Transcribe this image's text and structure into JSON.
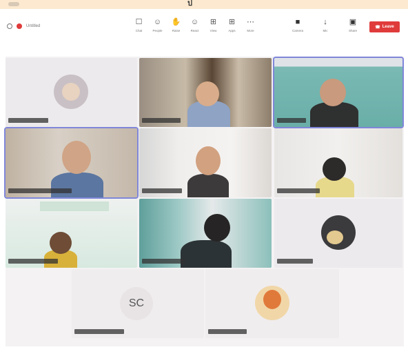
{
  "banner": {
    "text": "ป"
  },
  "toolbar": {
    "title": "Untitled",
    "items": [
      {
        "icon": "chat-icon",
        "glyph": "☐",
        "label": "Chat"
      },
      {
        "icon": "people-icon",
        "glyph": "☺",
        "label": "People"
      },
      {
        "icon": "raise-hand-icon",
        "glyph": "✋",
        "label": "Raise"
      },
      {
        "icon": "react-icon",
        "glyph": "☺",
        "label": "React"
      },
      {
        "icon": "view-icon",
        "glyph": "⊞",
        "label": "View"
      },
      {
        "icon": "apps-icon",
        "glyph": "⊞",
        "label": "Apps"
      },
      {
        "icon": "more-icon",
        "glyph": "⋯",
        "label": "More"
      }
    ],
    "devices": [
      {
        "icon": "camera-icon",
        "glyph": "■",
        "label": "Camera"
      },
      {
        "icon": "mic-icon",
        "glyph": "↓",
        "label": "Mic"
      },
      {
        "icon": "share-icon",
        "glyph": "▣",
        "label": "Share"
      }
    ],
    "leave_label": "Leave"
  },
  "participants": [
    {
      "name": "",
      "type": "avatar"
    },
    {
      "name": "",
      "type": "video"
    },
    {
      "name": "",
      "type": "video"
    },
    {
      "name": "",
      "type": "video"
    },
    {
      "name": "",
      "type": "video"
    },
    {
      "name": "",
      "type": "video"
    },
    {
      "name": "",
      "type": "video"
    },
    {
      "name": "",
      "type": "video"
    },
    {
      "name": "",
      "type": "avatar"
    },
    {
      "name": "",
      "type": "initials",
      "initials": "SC"
    },
    {
      "name": "",
      "type": "avatar"
    }
  ]
}
